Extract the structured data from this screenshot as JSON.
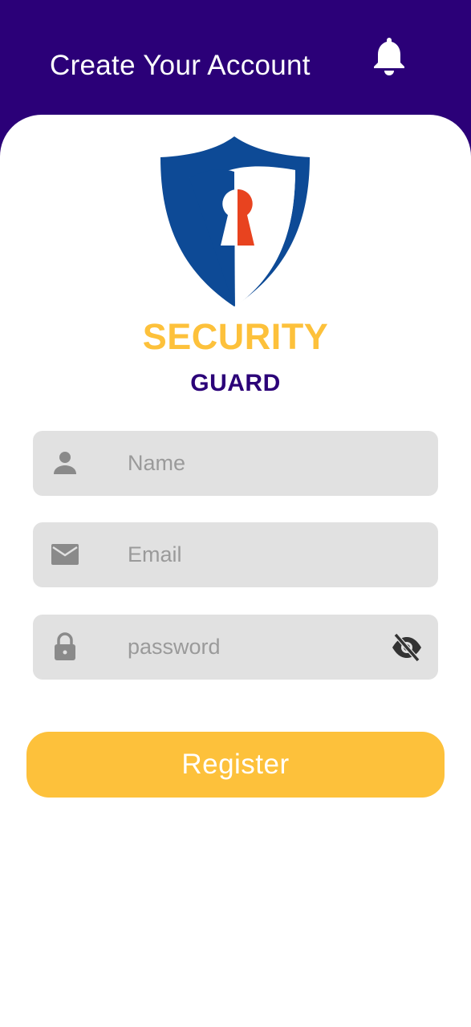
{
  "header": {
    "title": "Create Your Account",
    "notification_icon": "bell-icon"
  },
  "brand": {
    "logo_icon": "shield-keyhole-icon",
    "line1": "SECURITY",
    "line2": "GUARD"
  },
  "form": {
    "name": {
      "placeholder": "Name",
      "value": "",
      "icon": "person-icon"
    },
    "email": {
      "placeholder": "Email",
      "value": "",
      "icon": "mail-icon"
    },
    "password": {
      "placeholder": "password",
      "value": "",
      "icon": "lock-icon",
      "toggle_icon": "eye-off-icon"
    },
    "register_label": "Register"
  },
  "colors": {
    "primary": "#2b0078",
    "accent": "#fdc13b",
    "field_bg": "#e1e1e1",
    "logo_blue": "#0d4a96",
    "logo_red": "#e8431f"
  }
}
